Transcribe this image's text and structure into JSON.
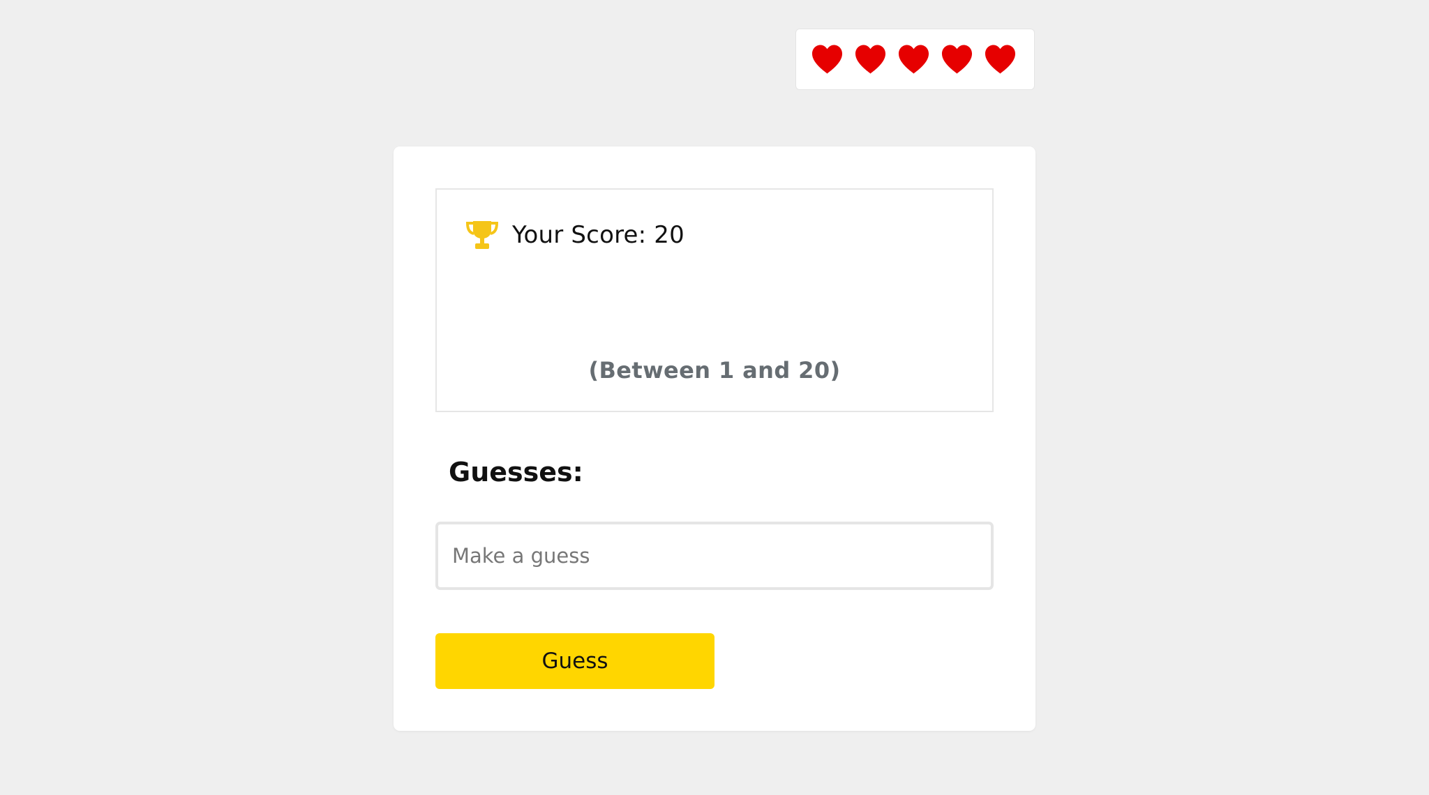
{
  "lives": {
    "count": 5,
    "max": 5,
    "heart_color": "#e60000"
  },
  "score": {
    "icon": "trophy-icon",
    "icon_color": "#f5c518",
    "text": "Your Score: 20"
  },
  "range_hint": "(Between 1 and 20)",
  "guesses": {
    "label": "Guesses:"
  },
  "input": {
    "placeholder": "Make a guess",
    "value": ""
  },
  "button": {
    "label": "Guess",
    "color": "#ffd600"
  }
}
